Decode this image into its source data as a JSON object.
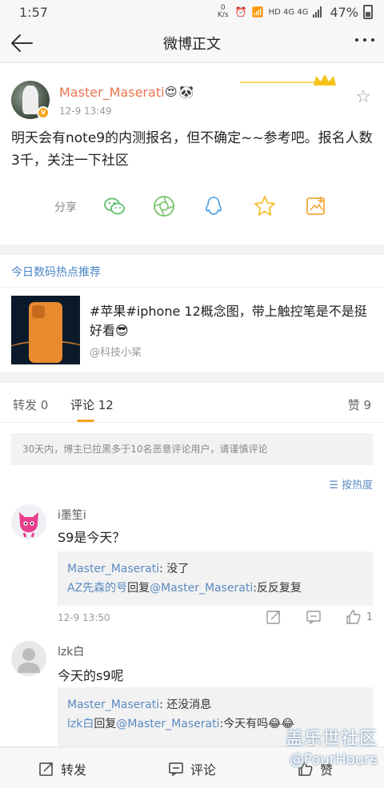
{
  "status_bar": {
    "time": "1:57",
    "net_speed": "0 K/s",
    "network": "HD 4G 4G",
    "battery": "47%"
  },
  "nav": {
    "title": "微博正文"
  },
  "post": {
    "author": "Master_Maserati",
    "time": "12-9 13:49",
    "content": "明天会有note9的内测报名，但不确定~~参考吧。报名人数3千，关注一下社区",
    "share_label": "分享",
    "badges": [
      "😍",
      "🐼"
    ]
  },
  "hot": {
    "section_title": "今日数码热点推荐",
    "headline": "#苹果#iphone 12概念图，带上触控笔是不是挺好看😎",
    "source": "@科技小桨"
  },
  "tabs": {
    "repost": "转发 0",
    "comment": "评论 12",
    "like": "赞 9"
  },
  "notice": "30天内，博主已拉黑多于10名恶意评论用户，请谨慎评论",
  "sort_label": "按热度",
  "comments": [
    {
      "user": "i墨笙i",
      "text": "S9是今天？",
      "replies": [
        {
          "name": "Master_Maserati",
          "mid": "",
          "text": ": 没了"
        },
        {
          "name": "AZ先森的号",
          "mid": "回复",
          "target": "@Master_Maserati",
          "text": ":反反复复"
        }
      ],
      "time": "12-9 13:50",
      "likes": "1"
    },
    {
      "user": "lzk白",
      "text": "今天的s9呢",
      "replies": [
        {
          "name": "Master_Maserati",
          "mid": "",
          "text": ": 还没消息"
        },
        {
          "name": "lzk白",
          "mid": "回复",
          "target": "@Master_Maserati",
          "text": ":今天有吗😂😂"
        }
      ]
    }
  ],
  "bottom_bar": {
    "repost": "转发",
    "comment": "评论",
    "like": "赞"
  },
  "watermark": {
    "line1": "盖乐世社区",
    "line2": "@FourHours"
  }
}
